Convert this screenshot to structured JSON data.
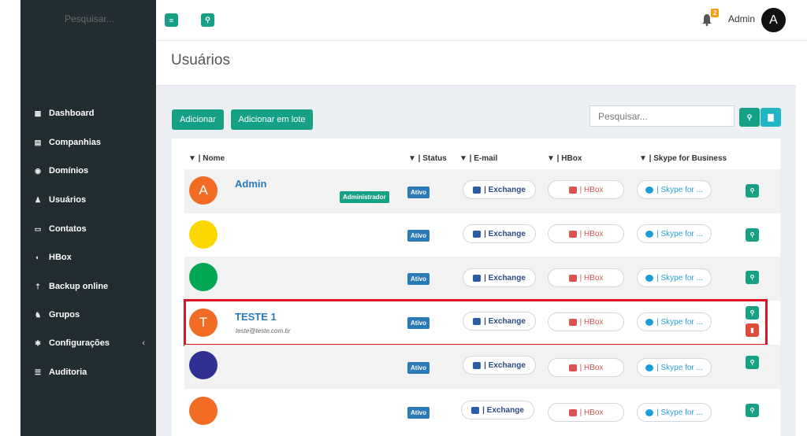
{
  "topbar": {
    "search_placeholder": "Pesquisar...",
    "notification_count": "2",
    "user_name": "Admin",
    "user_initial": "A"
  },
  "sidebar": {
    "items": [
      {
        "label": "Dashboard",
        "icon": "grid-icon"
      },
      {
        "label": "Companhias",
        "icon": "building-icon"
      },
      {
        "label": "Domínios",
        "icon": "globe-icon"
      },
      {
        "label": "Usuários",
        "icon": "user-icon"
      },
      {
        "label": "Contatos",
        "icon": "contact-card-icon"
      },
      {
        "label": "HBox",
        "icon": "hbox-icon"
      },
      {
        "label": "Backup online",
        "icon": "upload-icon"
      },
      {
        "label": "Grupos",
        "icon": "group-icon"
      },
      {
        "label": "Configurações",
        "icon": "gear-icon"
      },
      {
        "label": "Auditoria",
        "icon": "list-icon"
      }
    ]
  },
  "page": {
    "title": "Usuários",
    "add_button": "Adicionar",
    "bulk_add_button": "Adicionar em lote",
    "search_placeholder": "Pesquisar..."
  },
  "table": {
    "headers": {
      "name": "Nome",
      "status": "Status",
      "email": "E-mail",
      "hbox": "HBox",
      "skype": "Skype for Business"
    },
    "exchange_label": "Exchange",
    "hbox_label": "HBox",
    "skype_label": "Skype for ...",
    "rows": [
      {
        "initial": "A",
        "name": "Admin",
        "email": "",
        "role": "Administrador",
        "status": "Ativo",
        "avatar_color": "#f26b22"
      },
      {
        "initial": "",
        "name": "",
        "email": "",
        "role": "",
        "status": "Ativo",
        "avatar_color": "#fdd800"
      },
      {
        "initial": "",
        "name": "",
        "email": "",
        "role": "",
        "status": "Ativo",
        "avatar_color": "#00a651"
      },
      {
        "initial": "T",
        "name": "TESTE 1",
        "email": "teste@teste.com.br",
        "role": "",
        "status": "Ativo",
        "avatar_color": "#f26b22"
      },
      {
        "initial": "",
        "name": "",
        "email": "",
        "role": "",
        "status": "Ativo",
        "avatar_color": "#2e3192"
      },
      {
        "initial": "",
        "name": "",
        "email": "",
        "role": "",
        "status": "Ativo",
        "avatar_color": "#f26b22"
      }
    ]
  },
  "colors": {
    "sidebar_bg": "#222d32",
    "accent": "#16a086",
    "status_blue": "#2a7ab8",
    "highlight_red": "#e0141c"
  }
}
